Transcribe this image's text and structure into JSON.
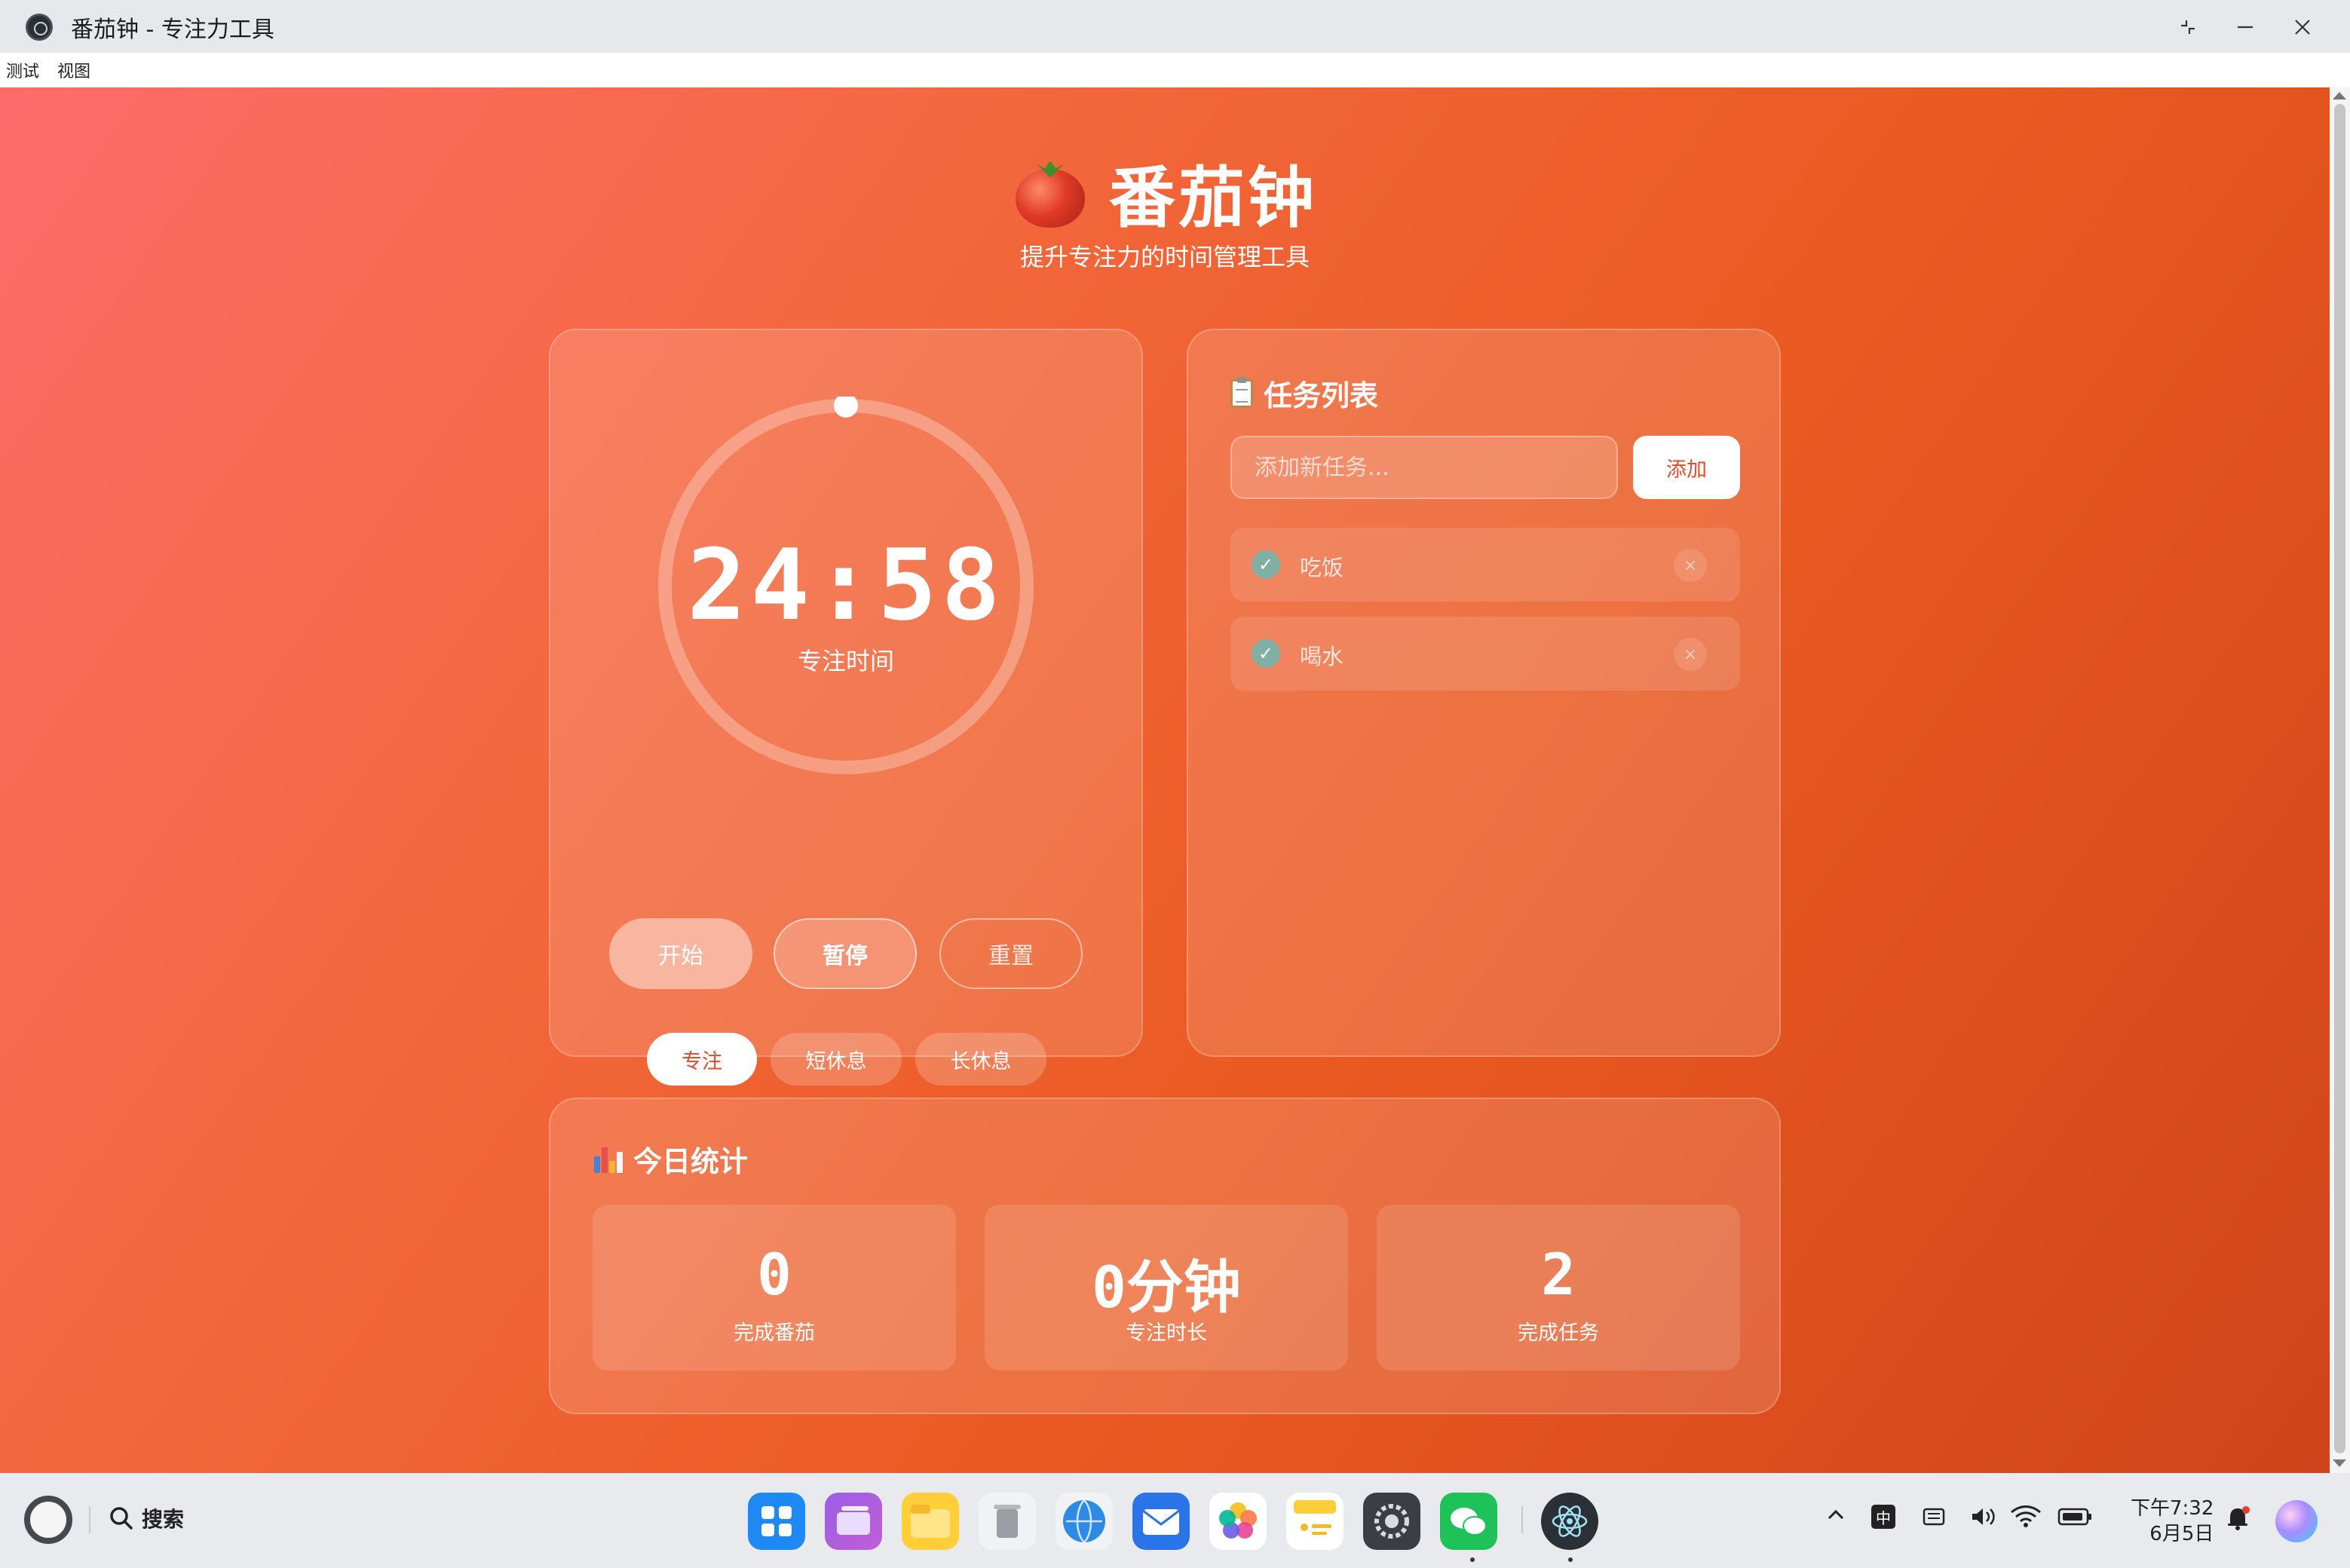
{
  "window": {
    "title": "番茄钟 - 专注力工具",
    "controls": {
      "restore_icon": "restore-icon",
      "minimize_icon": "minimize-icon",
      "close_icon": "close-icon"
    }
  },
  "menubar": {
    "items": [
      "测试",
      "视图"
    ]
  },
  "header": {
    "icon": "tomato-icon",
    "title": "番茄钟",
    "subtitle": "提升专注力的时间管理工具"
  },
  "timer": {
    "time": "24:58",
    "label": "专注时间",
    "progress": 0.001,
    "buttons": {
      "start": "开始",
      "pause": "暂停",
      "reset": "重置"
    },
    "modes": [
      "专注",
      "短休息",
      "长休息"
    ],
    "active_mode": "专注"
  },
  "tasks": {
    "title": "任务列表",
    "icon": "clipboard-icon",
    "input_placeholder": "添加新任务...",
    "add_label": "添加",
    "items": [
      {
        "text": "吃饭",
        "done": true
      },
      {
        "text": "喝水",
        "done": true
      }
    ]
  },
  "stats": {
    "title": "今日统计",
    "icon": "bar-chart-icon",
    "items": [
      {
        "value": "0",
        "label": "完成番茄"
      },
      {
        "value": "0分钟",
        "label": "专注时长"
      },
      {
        "value": "2",
        "label": "完成任务"
      }
    ]
  },
  "taskbar": {
    "search_label": "搜索",
    "apps": [
      "launcher-icon",
      "multitask-icon",
      "files-icon",
      "trash-icon",
      "browser-icon",
      "mail-icon",
      "photos-icon",
      "notes-icon",
      "settings-icon",
      "wechat-icon",
      "electron-app-icon"
    ],
    "tray": {
      "ime": "中",
      "time": "下午7:32",
      "date": "6月5日"
    }
  },
  "colors": {
    "accent": "#e34a2a",
    "check": "#7fb0a3",
    "gradient_start": "#ff6b6b",
    "gradient_end": "#d1441b"
  }
}
